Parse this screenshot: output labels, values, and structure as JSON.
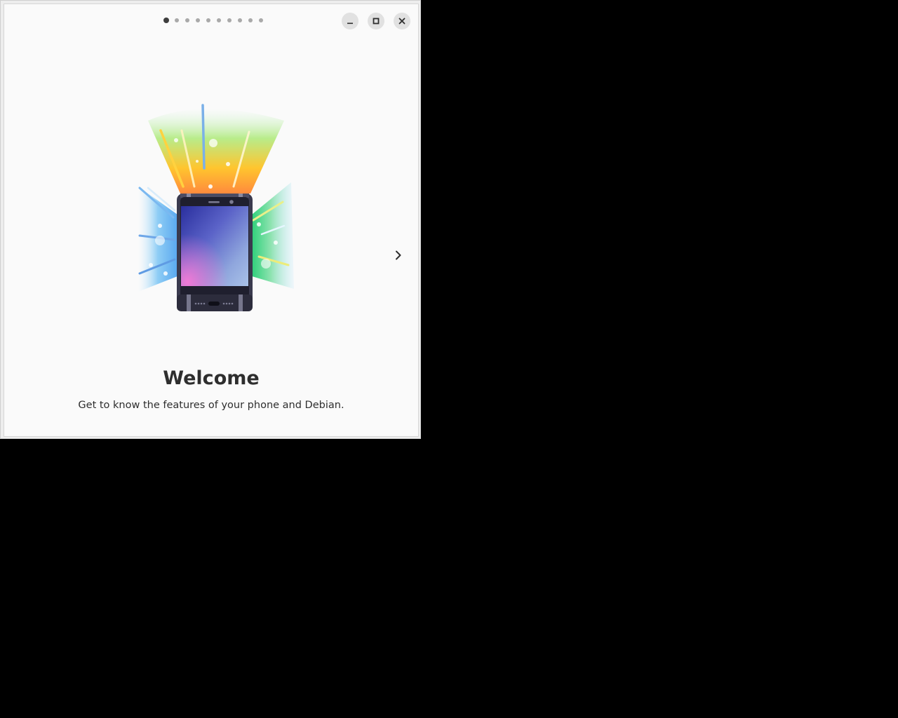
{
  "tour": {
    "page_count": 10,
    "current_page": 1,
    "page": {
      "title": "Welcome",
      "description": "Get to know the features of your phone and Debian."
    }
  },
  "window_controls": {
    "minimize_icon": "minimize-icon",
    "maximize_icon": "maximize-icon",
    "close_icon": "close-icon"
  },
  "navigation": {
    "next_icon": "chevron-right-icon"
  },
  "illustration": {
    "subject": "phone-icon"
  },
  "colors": {
    "desktop_background": "#000000",
    "window_background": "#fafafa",
    "text": "#2e2e2e",
    "active_dot": "#3d3d3d",
    "inactive_dot": "#a9a9a9"
  }
}
